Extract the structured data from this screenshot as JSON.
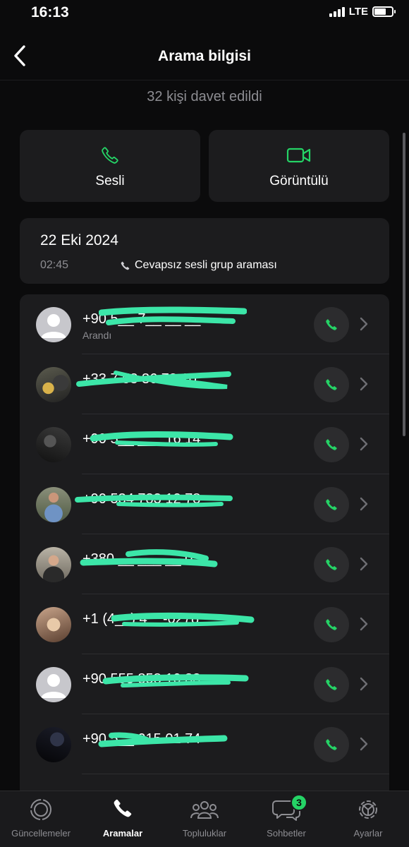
{
  "status_bar": {
    "time": "16:13",
    "network": "LTE"
  },
  "nav": {
    "title": "Arama bilgisi"
  },
  "invited_text": "32 kişi davet edildi",
  "actions": {
    "voice_label": "Sesli",
    "video_label": "Görüntülü"
  },
  "call": {
    "date": "22 Eki 2024",
    "time": "02:45",
    "type": "Cevapsız sesli grup araması"
  },
  "participants": [
    {
      "phone": "+90 5__ 7__ __ __",
      "subtitle": "Arandı",
      "avatar": "default-avatar"
    },
    {
      "phone": "+33 7 58 36 73 10",
      "subtitle": "",
      "avatar": "photo-avatar"
    },
    {
      "phone": "+90 5__ ___ 16 14",
      "subtitle": "",
      "avatar": "photo-avatar"
    },
    {
      "phone": "+90 534 783 12 78",
      "subtitle": "",
      "avatar": "photo-avatar"
    },
    {
      "phone": "+380 __ ___ __ 0",
      "subtitle": "",
      "avatar": "photo-avatar"
    },
    {
      "phone": "+1 (4__) 4__-0278",
      "subtitle": "",
      "avatar": "photo-avatar"
    },
    {
      "phone": "+90 555 858 10 83",
      "subtitle": "",
      "avatar": "default-avatar"
    },
    {
      "phone": "+90 5__ 015 01 74",
      "subtitle": "",
      "avatar": "photo-avatar"
    }
  ],
  "tabs": [
    {
      "label": "Güncellemeler",
      "icon": "updates-icon",
      "active": false
    },
    {
      "label": "Aramalar",
      "icon": "phone-icon",
      "active": true
    },
    {
      "label": "Topluluklar",
      "icon": "communities-icon",
      "active": false
    },
    {
      "label": "Sohbetler",
      "icon": "chats-icon",
      "active": false,
      "badge": "3"
    },
    {
      "label": "Ayarlar",
      "icon": "settings-icon",
      "active": false
    }
  ],
  "colors": {
    "accent": "#25d366",
    "background": "#0b0b0c",
    "card": "#1c1c1e",
    "secondary_text": "#8d8d92"
  }
}
